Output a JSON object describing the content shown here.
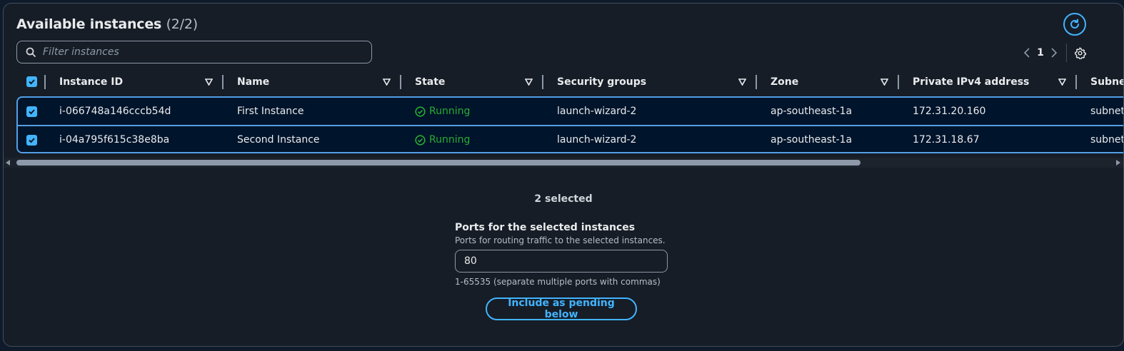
{
  "header": {
    "title": "Available instances",
    "count": "(2/2)"
  },
  "search": {
    "placeholder": "Filter instances"
  },
  "pagination": {
    "page": "1"
  },
  "table": {
    "columns": [
      "Instance ID",
      "Name",
      "State",
      "Security groups",
      "Zone",
      "Private IPv4 address",
      "Subnet"
    ],
    "rows": [
      {
        "id": "i-066748a146cccb54d",
        "name": "First Instance",
        "state": "Running",
        "sg": "launch-wizard-2",
        "zone": "ap-southeast-1a",
        "ip": "172.31.20.160",
        "subnet": "subnet"
      },
      {
        "id": "i-04a795f615c38e8ba",
        "name": "Second Instance",
        "state": "Running",
        "sg": "launch-wizard-2",
        "zone": "ap-southeast-1a",
        "ip": "172.31.18.67",
        "subnet": "subnet"
      }
    ]
  },
  "selection": {
    "summary": "2 selected"
  },
  "ports": {
    "label": "Ports for the selected instances",
    "description": "Ports for routing traffic to the selected instances.",
    "value": "80",
    "hint": "1-65535 (separate multiple ports with commas)"
  },
  "actions": {
    "include_label": "Include as pending below"
  },
  "colors": {
    "accent": "#42b4ff",
    "running": "#29ad32",
    "row_border": "#539fe5"
  }
}
